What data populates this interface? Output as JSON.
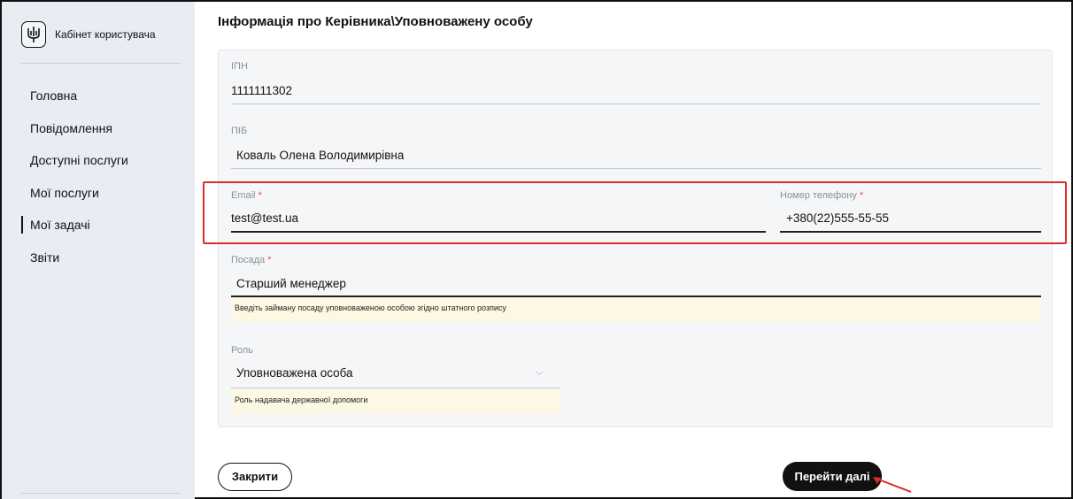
{
  "sidebar": {
    "brand_icon": "trident-icon",
    "brand_title": "Кабінет користувача",
    "items": [
      {
        "label": "Головна",
        "active": false
      },
      {
        "label": "Повідомлення",
        "active": false
      },
      {
        "label": "Доступні послуги",
        "active": false
      },
      {
        "label": "Мої послуги",
        "active": false
      },
      {
        "label": "Мої задачі",
        "active": true
      },
      {
        "label": "Звіти",
        "active": false
      }
    ]
  },
  "page": {
    "title": "Інформація про Керівника\\Уповноважену особу"
  },
  "form": {
    "ipn": {
      "label": "ІПН",
      "value": "1111111302"
    },
    "pib": {
      "label": "ПІБ",
      "value": "Коваль Олена Володимирівна"
    },
    "email": {
      "label": "Email",
      "required_mark": "*",
      "value": "test@test.ua"
    },
    "phone": {
      "label": "Номер телефону",
      "required_mark": "*",
      "value": "+380(22)555-55-55"
    },
    "position": {
      "label": "Посада",
      "required_mark": "*",
      "value": "Старший менеджер",
      "hint": "Введіть займану посаду уповноваженою особою згідно штатного розпису"
    },
    "role": {
      "label": "Роль",
      "value": "Уповноважена особа",
      "hint": "Роль надавача державної допомоги"
    }
  },
  "actions": {
    "close_label": "Закрити",
    "next_label": "Перейти далі"
  },
  "colors": {
    "annotation": "#e02b2b",
    "sidebar_bg": "#e7edf3",
    "card_bg": "#f5f6f8",
    "hint_bg": "#fdf8e4"
  }
}
